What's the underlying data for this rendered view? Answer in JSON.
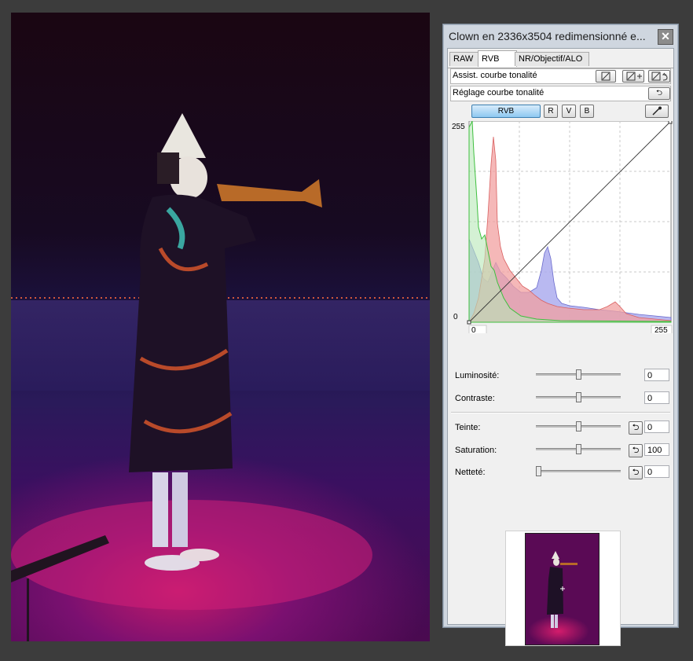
{
  "window": {
    "title": "Clown en 2336x3504 redimensionné e..."
  },
  "tabs": [
    {
      "label": "RAW"
    },
    {
      "label": "RVB"
    },
    {
      "label": "NR/Objectif/ALO"
    }
  ],
  "assist": {
    "label": "Assist. courbe tonalité"
  },
  "reglage": {
    "label": "Réglage courbe tonalité"
  },
  "channels": [
    {
      "label": "RVB"
    },
    {
      "label": "R"
    },
    {
      "label": "V"
    },
    {
      "label": "B"
    }
  ],
  "curve": {
    "y_max": "255",
    "y_min": "0",
    "x_min": "0",
    "x_max": "255"
  },
  "sliders": [
    {
      "label": "Luminosité:",
      "value": "0",
      "level": 0.5
    },
    {
      "label": "Contraste:",
      "value": "0",
      "level": 0.5
    },
    {
      "label": "Teinte:",
      "value": "0",
      "level": 0.5
    },
    {
      "label": "Saturation:",
      "value": "100",
      "level": 0.5
    },
    {
      "label": "Netteté:",
      "value": "0",
      "level": 0.0
    }
  ],
  "colors": {
    "red_hist": "#f2a0a0",
    "green_hist": "#3fbf3f",
    "blue_hist": "#a8a8ee",
    "active_channel": "#8ec8f1"
  },
  "icons": {
    "close": "close-icon",
    "reset": "undo-icon",
    "eyedropper": "eyedropper-icon"
  }
}
